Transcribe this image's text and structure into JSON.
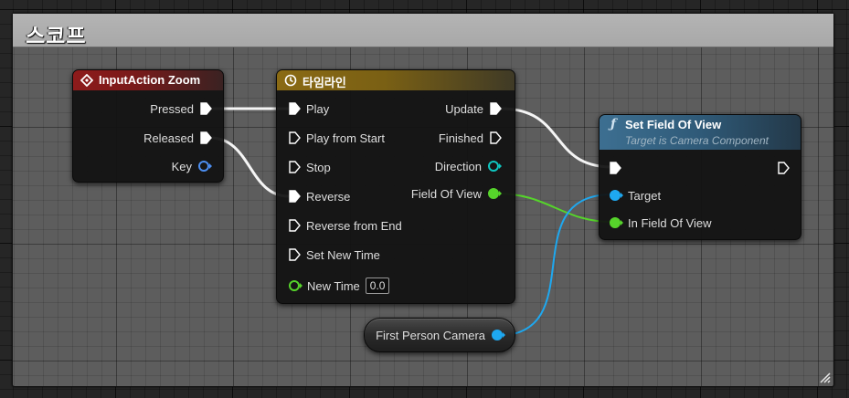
{
  "comment": {
    "title": "스코프"
  },
  "event_node": {
    "title": "InputAction Zoom",
    "pins": {
      "pressed": "Pressed",
      "released": "Released",
      "key": "Key"
    }
  },
  "timeline_node": {
    "title": "타임라인",
    "inputs": {
      "play": "Play",
      "play_from_start": "Play from Start",
      "stop": "Stop",
      "reverse": "Reverse",
      "reverse_from_end": "Reverse from End",
      "set_new_time": "Set New Time",
      "new_time": "New Time"
    },
    "new_time_value": "0.0",
    "outputs": {
      "update": "Update",
      "finished": "Finished",
      "direction": "Direction",
      "field_of_view": "Field Of View"
    }
  },
  "function_node": {
    "title": "Set Field Of View",
    "subtitle": "Target is Camera Component",
    "pins": {
      "target": "Target",
      "in_field_of_view": "In Field Of View"
    }
  },
  "variable_node": {
    "label": "First Person Camera"
  },
  "colors": {
    "exec": "#ffffff",
    "float": "#56d42b",
    "object": "#1ea8f0",
    "struct": "#0fc6c0",
    "key": "#4c8ef0",
    "comment_header": "#b0b0b0",
    "event_header": "#8e1b1b",
    "timeline_header": "#8a6a14",
    "function_header": "#3d6f91"
  }
}
